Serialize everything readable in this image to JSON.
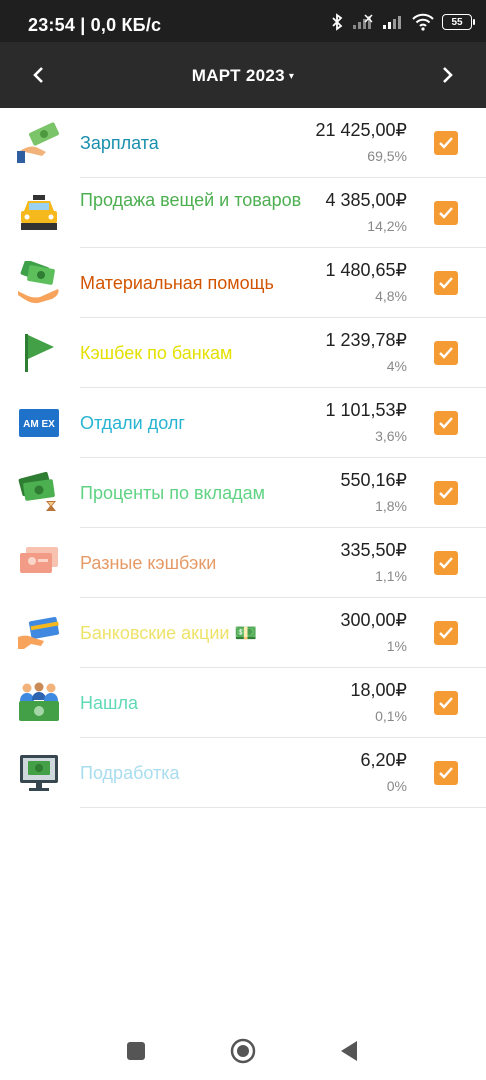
{
  "status_bar": {
    "time": "23:54 | 0,0 КБ/с",
    "battery": "55"
  },
  "header": {
    "title": "МАРТ 2023",
    "caret": "▾"
  },
  "items": [
    {
      "name": "Зарплата",
      "amount": "21 425,00₽",
      "percent": "69,5%",
      "color": "#1a8fae",
      "icon": "money-hand-icon",
      "checked": true
    },
    {
      "name": "Продажа вещей и товаров",
      "amount": "4 385,00₽",
      "percent": "14,2%",
      "color": "#4caf50",
      "icon": "taxi-icon",
      "checked": true
    },
    {
      "name": "Материальная помощь",
      "amount": "1 480,65₽",
      "percent": "4,8%",
      "color": "#d35400",
      "icon": "cash-hands-icon",
      "checked": true
    },
    {
      "name": "Кэшбек по банкам",
      "amount": "1 239,78₽",
      "percent": "4%",
      "color": "#e4e000",
      "icon": "flag-icon",
      "checked": true
    },
    {
      "name": "Отдали долг",
      "amount": "1 101,53₽",
      "percent": "3,6%",
      "color": "#26b4d2",
      "icon": "amex-card-icon",
      "checked": true
    },
    {
      "name": "Проценты по вкладам",
      "amount": "550,16₽",
      "percent": "1,8%",
      "color": "#5fd383",
      "icon": "money-hourglass-icon",
      "checked": true
    },
    {
      "name": "Разные кэшбэки",
      "amount": "335,50₽",
      "percent": "1,1%",
      "color": "#e59a66",
      "icon": "coupons-icon",
      "checked": true
    },
    {
      "name": "Банковские акции 💵",
      "amount": "300,00₽",
      "percent": "1%",
      "color": "#eee36a",
      "icon": "card-hand-icon",
      "checked": true
    },
    {
      "name": "Нашла",
      "amount": "18,00₽",
      "percent": "0,1%",
      "color": "#5fd9b6",
      "icon": "people-money-icon",
      "checked": true
    },
    {
      "name": "Подработка",
      "amount": "6,20₽",
      "percent": "0%",
      "color": "#a7ddef",
      "icon": "monitor-money-icon",
      "checked": true
    }
  ]
}
